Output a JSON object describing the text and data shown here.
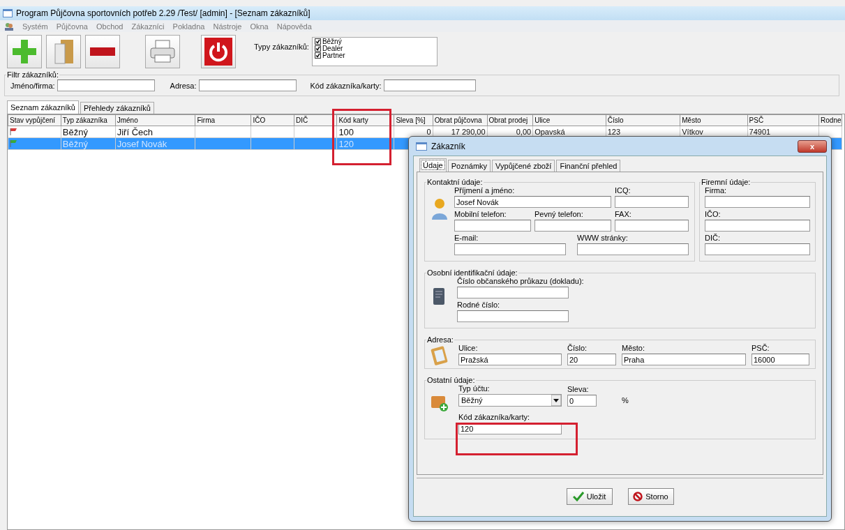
{
  "window": {
    "title": "Program Půjčovna sportovních potřeb 2.29 /Test/ [admin] - [Seznam zákazníků]"
  },
  "menu": [
    "Systém",
    "Půjčovna",
    "Obchod",
    "Zákazníci",
    "Pokladna",
    "Nástroje",
    "Okna",
    "Nápověda"
  ],
  "toolbar": {
    "buttons": [
      {
        "kind": "add"
      },
      {
        "kind": "open"
      },
      {
        "kind": "remove"
      },
      {
        "kind": "print"
      },
      {
        "kind": "power"
      }
    ],
    "customer_types": {
      "label": "Typy zákazníků:",
      "items": [
        {
          "label": "Běžný",
          "checked": true
        },
        {
          "label": "Dealer",
          "checked": true
        },
        {
          "label": "Partner",
          "checked": true
        }
      ]
    }
  },
  "filter": {
    "title": "Filtr zákazníků:",
    "fields": [
      {
        "label": "Jméno/firma:"
      },
      {
        "label": "Adresa:"
      },
      {
        "label": "Kód zákazníka/karty:"
      }
    ]
  },
  "tabs": [
    {
      "label": "Seznam zákazníků",
      "selected": true
    },
    {
      "label": "Přehledy zákazníků",
      "selected": false
    }
  ],
  "table": {
    "columns": [
      "Stav vypůjčení",
      "Typ zákazníka",
      "Jméno",
      "Firma",
      "IČO",
      "DIČ",
      "Kód karty",
      "Sleva [%]",
      "Obrat půjčovna",
      "Obrat prodej",
      "Ulice",
      "Číslo",
      "Město",
      "PSČ",
      "Rodne"
    ],
    "rows": [
      {
        "color": "#d83a3a",
        "selected": false,
        "cells": [
          "",
          "Běžný",
          "Jiří Čech",
          "",
          "",
          "",
          "100",
          "0",
          "17 290,00",
          "0,00",
          "Opavská",
          "123",
          "Vítkov",
          "74901",
          ""
        ]
      },
      {
        "color": "#3aa83a",
        "selected": true,
        "cells": [
          "",
          "Běžný",
          "Josef Novák",
          "",
          "",
          "",
          "120",
          "",
          "",
          "",
          "",
          "",
          "",
          "",
          ""
        ]
      }
    ]
  },
  "dialog": {
    "title": "Zákazník",
    "close": "x",
    "tabs": [
      {
        "label": "Údaje",
        "selected": true
      },
      {
        "label": "Poznámky",
        "selected": false
      },
      {
        "label": "Vypůjčené zboží",
        "selected": false
      },
      {
        "label": "Finanční přehled",
        "selected": false
      }
    ],
    "contact": {
      "title": "Kontaktní údaje:",
      "name_label": "Příjmení a jméno:",
      "name_value": "Josef Novák",
      "icq_label": "ICQ:",
      "mobile_label": "Mobilní telefon:",
      "phone_label": "Pevný telefon:",
      "fax_label": "FAX:",
      "email_label": "E-mail:",
      "web_label": "WWW stránky:"
    },
    "company": {
      "title": "Firemní údaje:",
      "fields": [
        {
          "label": "Firma:"
        },
        {
          "label": "IČO:"
        },
        {
          "label": "DIČ:"
        }
      ]
    },
    "identity": {
      "title": "Osobní identifikační údaje:",
      "fields": [
        {
          "label": "Číslo občanského průkazu (dokladu):"
        },
        {
          "label": "Rodné číslo:"
        }
      ]
    },
    "address": {
      "title": "Adresa:",
      "fields": [
        {
          "label": "Ulice:",
          "value": "Pražská"
        },
        {
          "label": "Číslo:",
          "value": "20"
        },
        {
          "label": "Město:",
          "value": "Praha"
        },
        {
          "label": "PSČ:",
          "value": "16000"
        }
      ]
    },
    "other": {
      "title": "Ostatní údaje:",
      "account_label": "Typ účtu:",
      "account_value": "Běžný",
      "discount_label": "Sleva:",
      "discount_value": "0",
      "percent": "%",
      "code_label": "Kód zákazníka/karty:",
      "code_value": "120"
    },
    "buttons": [
      {
        "kind": "save",
        "label": "Uložit"
      },
      {
        "kind": "cancel",
        "label": "Storno"
      }
    ]
  }
}
